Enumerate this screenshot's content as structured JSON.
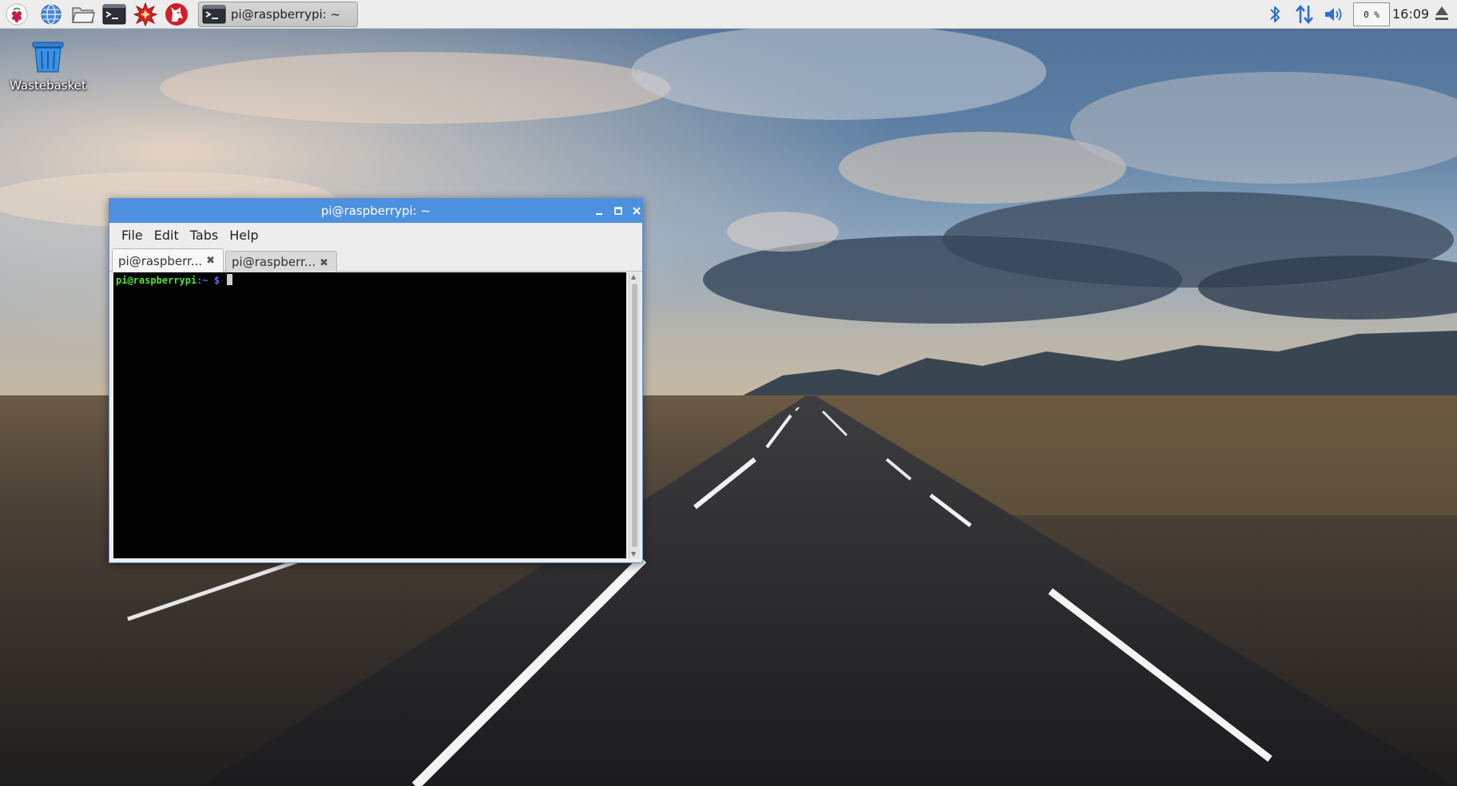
{
  "panel": {
    "launchers": [
      {
        "name": "raspberry-menu",
        "icon": "raspberry-icon"
      },
      {
        "name": "web-browser",
        "icon": "globe-icon"
      },
      {
        "name": "file-manager",
        "icon": "folder-icon"
      },
      {
        "name": "terminal",
        "icon": "terminal-icon"
      },
      {
        "name": "mathematica",
        "icon": "mathematica-star-icon"
      },
      {
        "name": "wolfram",
        "icon": "wolf-icon"
      }
    ],
    "task_button": {
      "label": "pi@raspberrypi: ~",
      "icon": "terminal-icon"
    },
    "tray": {
      "bluetooth_icon": "bluetooth-icon",
      "network_icon": "network-arrows-icon",
      "volume_icon": "speaker-icon",
      "cpu_usage": "0 %",
      "clock": "16:09",
      "eject_icon": "eject-icon"
    }
  },
  "desktop": {
    "icons": [
      {
        "label": "Wastebasket",
        "icon": "wastebasket-icon"
      }
    ]
  },
  "terminal_window": {
    "title": "pi@raspberrypi: ~",
    "controls": [
      "minimize",
      "maximize",
      "close"
    ],
    "menu": [
      "File",
      "Edit",
      "Tabs",
      "Help"
    ],
    "tabs": [
      {
        "label": "pi@raspberr...",
        "active": true
      },
      {
        "label": "pi@raspberr...",
        "active": false
      }
    ],
    "tab_close_glyph": "✖",
    "prompt": {
      "user_host": "pi@raspberrypi",
      "path": ":~ $"
    }
  },
  "colors": {
    "titlebar": "#4d90e0",
    "prompt_user": "#55e13a",
    "prompt_path": "#5c6cff",
    "terminal_bg": "#000000"
  }
}
